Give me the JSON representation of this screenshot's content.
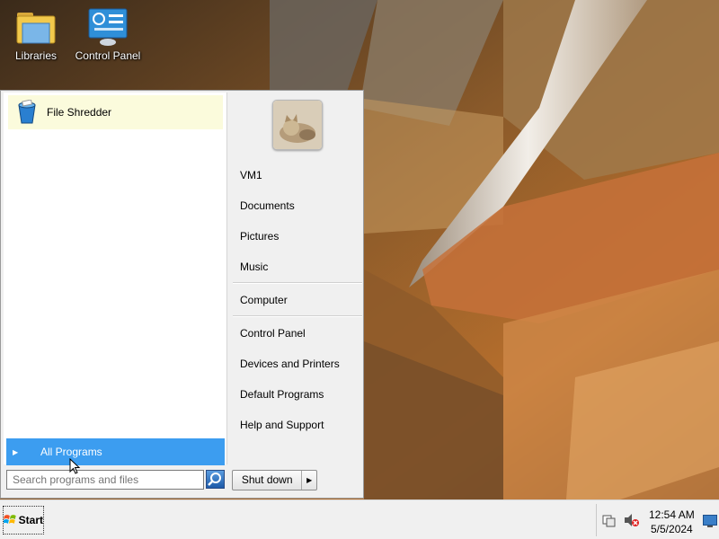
{
  "desktop": {
    "icons": [
      {
        "label": "Libraries",
        "icon": "libraries-folder-icon"
      },
      {
        "label": "Control Panel",
        "icon": "control-panel-icon"
      }
    ]
  },
  "start_menu": {
    "pinned": [
      {
        "label": "File Shredder",
        "icon": "file-shredder-icon"
      }
    ],
    "all_programs_label": "All Programs",
    "search_placeholder": "Search programs and files",
    "right_items": {
      "user": "VM1",
      "documents": "Documents",
      "pictures": "Pictures",
      "music": "Music",
      "computer": "Computer",
      "control_panel": "Control Panel",
      "devices_printers": "Devices and Printers",
      "default_programs": "Default Programs",
      "help_support": "Help and Support"
    },
    "shutdown_label": "Shut down"
  },
  "taskbar": {
    "start_label": "Start",
    "time": "12:54 AM",
    "date": "5/5/2024"
  },
  "colors": {
    "highlight": "#3c9df0",
    "pinned_hover": "#fbfbdc",
    "menu_bg": "#f0f0f0"
  }
}
